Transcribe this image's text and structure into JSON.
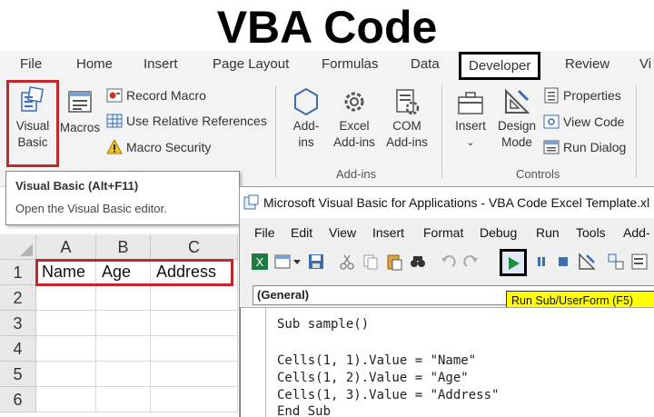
{
  "headline": "VBA Code",
  "ribbon": {
    "tabs": [
      "File",
      "Home",
      "Insert",
      "Page Layout",
      "Formulas",
      "Data",
      "Developer",
      "Review",
      "Vi"
    ],
    "code_group": {
      "visual_basic": [
        "Visual",
        "Basic"
      ],
      "macros": "Macros",
      "record_macro": "Record Macro",
      "relative_refs": "Use Relative References",
      "macro_security": "Macro Security"
    },
    "addins_group": {
      "addins": [
        "Add-",
        "ins"
      ],
      "excel_addins": [
        "Excel",
        "Add-ins"
      ],
      "com_addins": [
        "COM",
        "Add-ins"
      ],
      "label": "Add-ins"
    },
    "controls_group": {
      "insert": "Insert",
      "design_mode": [
        "Design",
        "Mode"
      ],
      "properties": "Properties",
      "view_code": "View Code",
      "run_dialog": "Run Dialog",
      "label": "Controls"
    }
  },
  "tooltip": {
    "title": "Visual Basic (Alt+F11)",
    "description": "Open the Visual Basic editor."
  },
  "sheet": {
    "columns": [
      "A",
      "B",
      "C"
    ],
    "rows": [
      "1",
      "2",
      "3",
      "4",
      "5",
      "6"
    ],
    "row1": [
      "Name",
      "Age",
      "Address"
    ]
  },
  "vba": {
    "title": "Microsoft Visual Basic for Applications - VBA Code Excel Template.xl",
    "menu": [
      "File",
      "Edit",
      "View",
      "Insert",
      "Format",
      "Debug",
      "Run",
      "Tools",
      "Add-"
    ],
    "general": "(General)",
    "run_tooltip": "Run Sub/UserForm (F5)",
    "code": [
      "Sub sample()",
      "",
      "Cells(1, 1).Value = \"Name\"",
      "Cells(1, 2).Value = \"Age\"",
      "Cells(1, 3).Value = \"Address\"",
      "End Sub"
    ]
  },
  "colors": {
    "highlight_red": "#c0282d",
    "tooltip_yellow": "#ffff00",
    "run_green": "#1e8e3e"
  }
}
